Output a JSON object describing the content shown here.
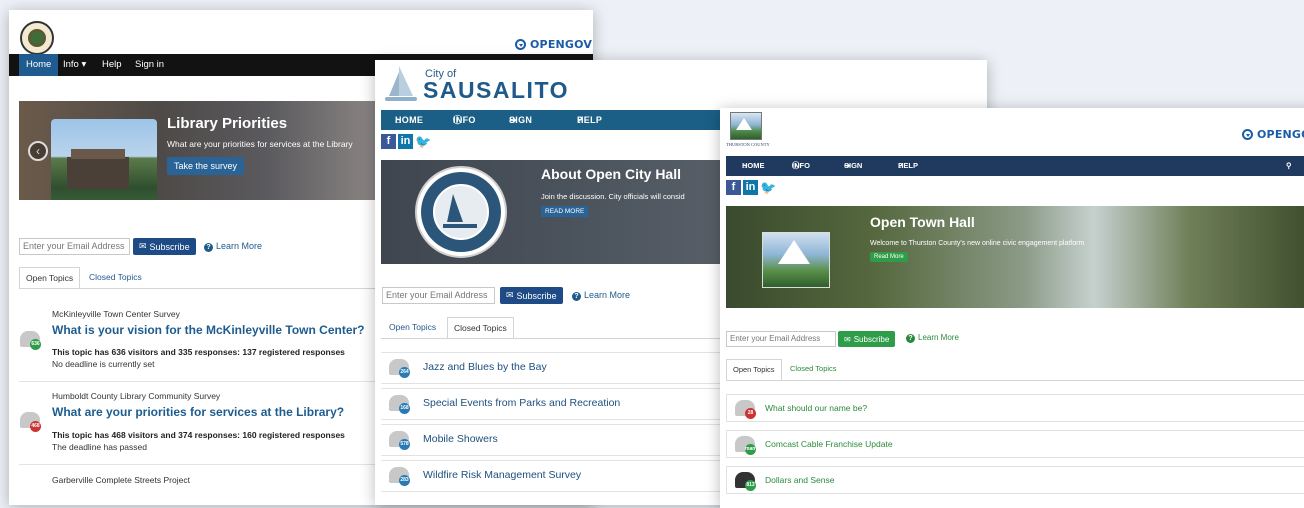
{
  "win1": {
    "brand": "OPENGOV",
    "nav": [
      "Home",
      "Info ▾",
      "Help",
      "Sign in"
    ],
    "hero": {
      "title": "Library Priorities",
      "subtitle": "What are your priorities for services at the Library",
      "button": "Take the survey"
    },
    "email_placeholder": "Enter your Email Address",
    "subscribe": "Subscribe",
    "learn_more": "Learn More",
    "tabs": [
      "Open Topics",
      "Closed Topics"
    ],
    "topics": [
      {
        "type": "McKinleyville Town Center Survey",
        "title": "What is your vision for the McKinleyville Town Center?",
        "badge": "636",
        "stats": "This topic has 636 visitors and 335 responses: 137 registered responses",
        "deadline": "No deadline is currently set"
      },
      {
        "type": "Humboldt County Library Community Survey",
        "title": "What are your priorities for services at the Library?",
        "badge": "468",
        "stats": "This topic has 468 visitors and 374 responses: 160 registered responses",
        "deadline": "The deadline has passed"
      },
      {
        "type": "Garberville Complete Streets Project"
      }
    ]
  },
  "win2": {
    "city_small": "City of",
    "city_big": "SAUSALITO",
    "nav": [
      "HOME",
      "INFO ▾",
      "SIGN IN",
      "HELP"
    ],
    "hero": {
      "title": "About Open City Hall",
      "subtitle": "Join the discussion. City officials will consid",
      "button": "READ MORE"
    },
    "seal": {
      "top": "CITY OF SAUSALITO",
      "bottom": "MARIN CO. CAL.",
      "band": "INCORPORATED",
      "date": "SEPTEMBER 4 1893"
    },
    "email_placeholder": "Enter your Email Address",
    "subscribe": "Subscribe",
    "learn_more": "Learn More",
    "tabs": [
      "Open Topics",
      "Closed Topics"
    ],
    "topics": [
      {
        "title": "Jazz and Blues by the Bay",
        "badge": "264"
      },
      {
        "title": "Special Events from Parks and Recreation",
        "badge": "168"
      },
      {
        "title": "Mobile Showers",
        "badge": "578"
      },
      {
        "title": "Wildfire Risk Management Survey",
        "badge": "283"
      }
    ]
  },
  "win3": {
    "logo_text": "THURSTON COUNTY",
    "brand": "OPENGOV",
    "nav": [
      "HOME",
      "INFO ▾",
      "SIGN IN",
      "HELP"
    ],
    "hero": {
      "title": "Open Town Hall",
      "subtitle": "Welcome to Thurston County's new online civic engagement platform",
      "button": "Read More"
    },
    "email_placeholder": "Enter your Email Address",
    "subscribe": "Subscribe",
    "learn_more": "Learn More",
    "tabs": [
      "Open Topics",
      "Closed Topics"
    ],
    "topics": [
      {
        "title": "What should our name be?",
        "badge": "28"
      },
      {
        "title": "Comcast Cable Franchise Update",
        "badge": "many"
      },
      {
        "title": "Dollars and Sense",
        "badge": "813"
      }
    ]
  },
  "colors": {
    "w1_nav": "#121212",
    "w2_nav": "#1b5f86",
    "w3_nav": "#1f3a5e",
    "w2_subscribe": "#1e4a86",
    "w3_subscribe": "#2e9c48",
    "badge_red": "#cc3333",
    "badge_green": "#2e9c48",
    "badge_blue": "#2b7ab5"
  }
}
